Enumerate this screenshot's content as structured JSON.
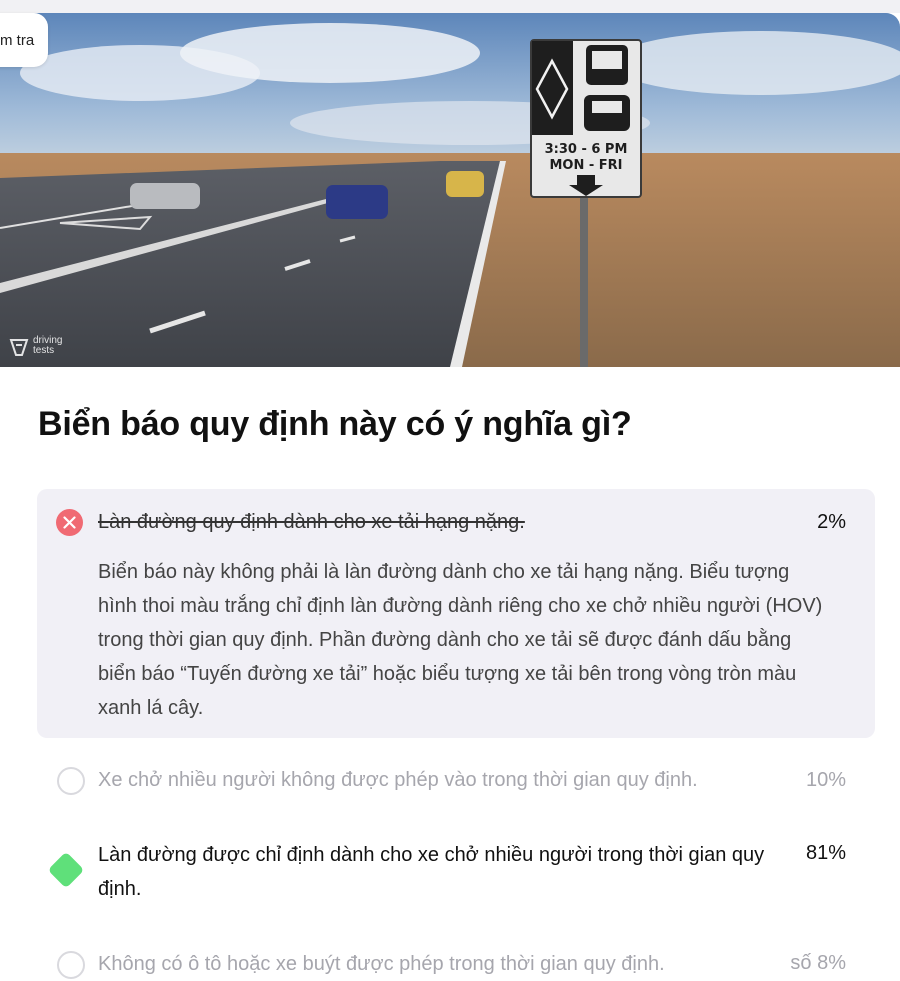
{
  "tag": {
    "label": "m tra"
  },
  "hero": {
    "watermark": "driving tests",
    "sign": {
      "time": "3:30 - 6 PM",
      "days": "MON - FRI"
    }
  },
  "question": {
    "title": "Biển báo quy định này có ý nghĩa gì?"
  },
  "answers": [
    {
      "text": "Làn đường quy định dành cho xe tải hạng nặng.",
      "percent": "2%",
      "status": "incorrect",
      "explanation": "Biển báo này không phải là làn đường dành cho xe tải hạng nặng. Biểu tượng hình thoi màu trắng chỉ định làn đường dành riêng cho xe chở nhiều người (HOV) trong thời gian quy định. Phần đường dành cho xe tải sẽ được đánh dấu bằng biển báo “Tuyến đường xe tải” hoặc biểu tượng xe tải bên trong vòng tròn màu xanh lá cây."
    },
    {
      "text": "Xe chở nhiều người không được phép vào trong thời gian quy định.",
      "percent": "10%",
      "status": "unselected"
    },
    {
      "text": "Làn đường được chỉ định dành cho xe chở nhiều người trong thời gian quy định.",
      "percent": "81%",
      "status": "correct"
    },
    {
      "text": "Không có ô tô hoặc xe buýt được phép trong thời gian quy định.",
      "percent": "số 8%",
      "status": "unselected"
    }
  ],
  "colors": {
    "incorrect": "#f06a73",
    "correct": "#5fe07a",
    "card": "#f1f0f6"
  }
}
